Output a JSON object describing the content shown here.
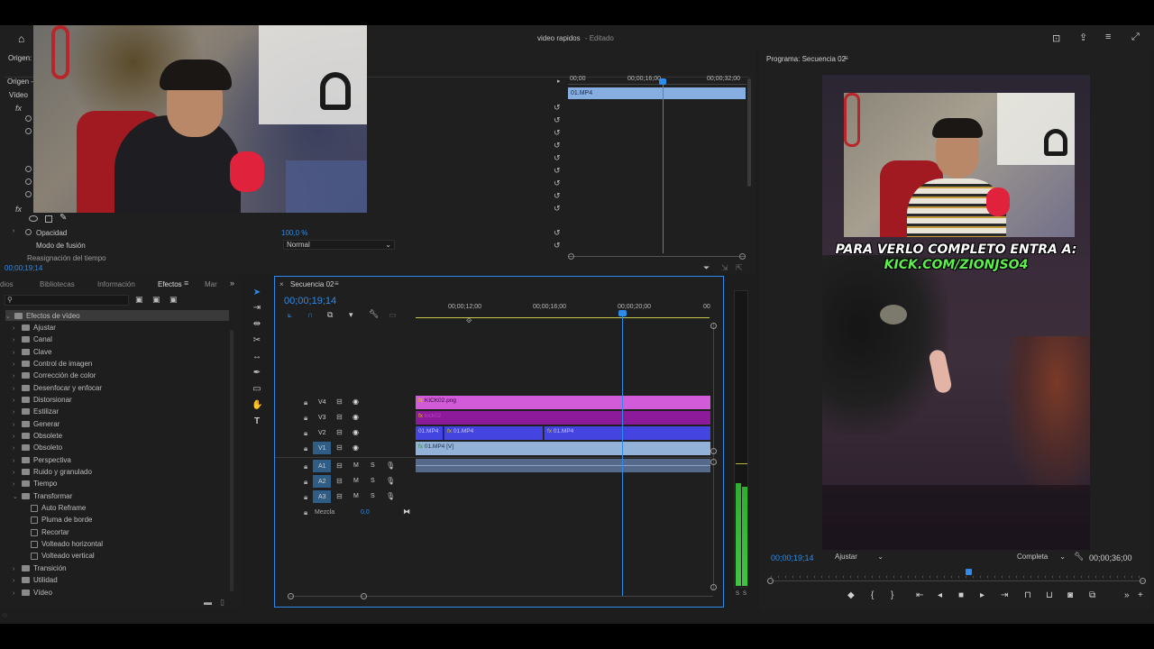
{
  "window": {
    "title": "video rapidos",
    "state": "- Editado"
  },
  "source_panel": {
    "tab": "Origen:",
    "sub": "Origen -",
    "section": "Vídeo",
    "opacity_label": "Opacidad",
    "opacity_value": "100,0 %",
    "blend_label": "Modo de fusión",
    "blend_value": "Normal",
    "remap_label": "Reasignación del tiempo",
    "timecode": "00;00;19;14",
    "mini_clip": "01.MP4",
    "ruler": [
      "00;00",
      "00;00;16;00",
      "00;00;32;00"
    ]
  },
  "program_monitor": {
    "title": "Programa: Secuencia 02",
    "overlay_line1": "PARA VERLO COMPLETO ENTRA A:",
    "overlay_line2": "KICK.COM/ZIONJSO4",
    "timecode_current": "00;00;19;14",
    "fit": "Ajustar",
    "quality": "Completa",
    "timecode_duration": "00;00;36;00"
  },
  "effects_panel": {
    "tabs": [
      "dios",
      "Bibliotecas",
      "Información",
      "Efectos",
      "Mar"
    ],
    "active_tab": "Efectos",
    "root": "Efectos de vídeo",
    "items": [
      "Ajustar",
      "Canal",
      "Clave",
      "Control de imagen",
      "Corrección de color",
      "Desenfocar y enfocar",
      "Distorsionar",
      "Estilizar",
      "Generar",
      "Obsolete",
      "Obsoleto",
      "Perspectiva",
      "Ruido y granulado",
      "Tiempo",
      "Transformar"
    ],
    "transform_children": [
      "Auto Reframe",
      "Pluma de borde",
      "Recortar",
      "Volteado horizontal",
      "Volteado vertical"
    ],
    "after": [
      "Transición",
      "Utilidad",
      "Vídeo"
    ]
  },
  "timeline": {
    "tab": "Secuencia 02",
    "timecode": "00;00;19;14",
    "ruler": [
      "00;00;12;00",
      "00;00;16;00",
      "00;00;20;00",
      "00"
    ],
    "video_tracks": [
      "V4",
      "V3",
      "V2",
      "V1"
    ],
    "audio_tracks": [
      "A1",
      "A2",
      "A3"
    ],
    "mix_label": "Mezcla",
    "mix_value": "0,0",
    "clips": {
      "v4": "KICK02.png",
      "v3": "kick02",
      "v2a": "01.MP4",
      "v2b": "01.MP4",
      "v2c": "01.MP4",
      "v1": "01.MP4 [V]"
    },
    "meter_labels": [
      "S",
      "S"
    ]
  },
  "colors": {
    "accent_blue": "#2d8ceb",
    "clip_v4": "#d15bd8",
    "clip_v3": "#8d1a9a",
    "clip_v2": "#4444e0",
    "clip_v1": "#93b2d8",
    "audio_meter": "#3fbf3f"
  }
}
